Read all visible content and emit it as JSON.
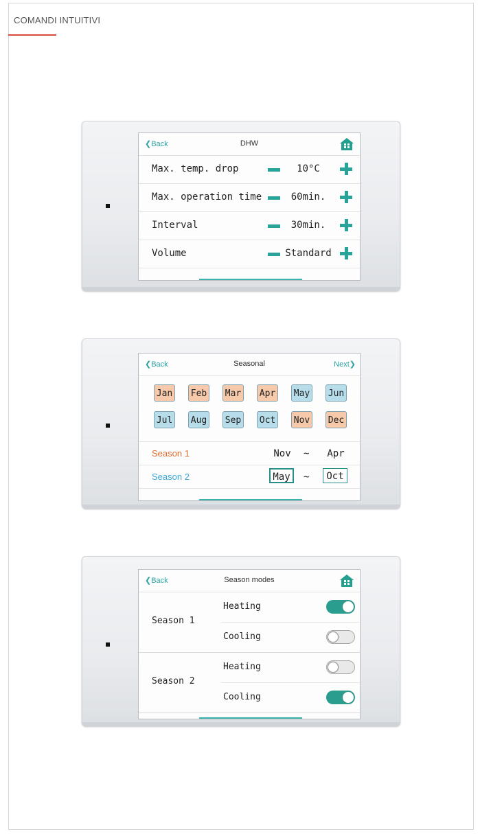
{
  "header": {
    "label": "COMANDI INTUITIVI"
  },
  "colors": {
    "accent": "#27a39a",
    "warm_month": "#f6c9aa",
    "cold_month": "#b7dcea",
    "season1": "#e06a2c",
    "season2": "#3aa7d6",
    "header_line": "#d9473b"
  },
  "dhw": {
    "back": "Back",
    "title": "DHW",
    "home_icon": "home-icon",
    "rows": [
      {
        "label": "Max. temp. drop",
        "value": "10°C"
      },
      {
        "label": "Max. operation time",
        "value": "60min."
      },
      {
        "label": "Interval",
        "value": "30min."
      },
      {
        "label": "Volume",
        "value": "Standard"
      }
    ]
  },
  "seasonal": {
    "back": "Back",
    "title": "Seasonal",
    "next": "Next",
    "months": [
      {
        "name": "Jan",
        "season": "warm"
      },
      {
        "name": "Feb",
        "season": "warm"
      },
      {
        "name": "Mar",
        "season": "warm"
      },
      {
        "name": "Apr",
        "season": "warm"
      },
      {
        "name": "May",
        "season": "cold"
      },
      {
        "name": "Jun",
        "season": "cold"
      },
      {
        "name": "Jul",
        "season": "cold"
      },
      {
        "name": "Aug",
        "season": "cold"
      },
      {
        "name": "Sep",
        "season": "cold"
      },
      {
        "name": "Oct",
        "season": "cold"
      },
      {
        "name": "Nov",
        "season": "warm"
      },
      {
        "name": "Dec",
        "season": "warm"
      }
    ],
    "season1": {
      "label": "Season 1",
      "from": "Nov",
      "sep": "~",
      "to": "Apr"
    },
    "season2": {
      "label": "Season 2",
      "from": "May",
      "sep": "~",
      "to": "Oct"
    }
  },
  "modes": {
    "back": "Back",
    "title": "Season modes",
    "home_icon": "home-icon",
    "seasons": [
      {
        "label": "Season 1",
        "heating": "Heating",
        "heating_on": true,
        "cooling": "Cooling",
        "cooling_on": false
      },
      {
        "label": "Season 2",
        "heating": "Heating",
        "heating_on": false,
        "cooling": "Cooling",
        "cooling_on": true
      }
    ]
  }
}
